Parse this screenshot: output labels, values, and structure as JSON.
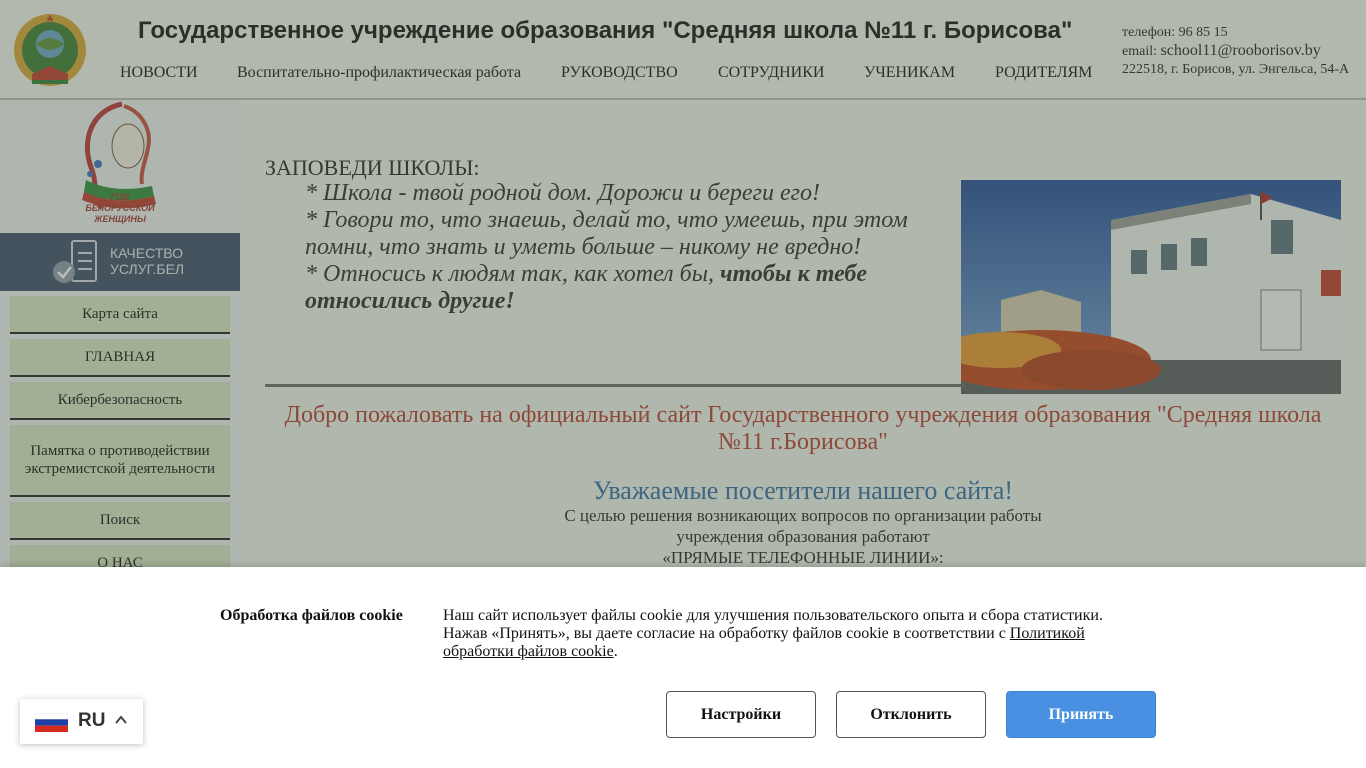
{
  "header": {
    "title": "Государственное учреждение образования \"Средняя школа №11 г. Борисова\"",
    "nav": [
      "НОВОСТИ",
      "Воспитательно-профилактическая работа",
      "РУКОВОДСТВО",
      "СОТРУДНИКИ",
      "УЧЕНИКАМ",
      "РОДИТЕЛЯМ"
    ],
    "contacts": {
      "phone": "телефон: 96 85 15",
      "email_label": "email:",
      "email": "school11@rooborisov.by",
      "address": "222518, г. Борисов, ул. Энгельса, 54-А"
    }
  },
  "sidebar": {
    "women_logo_text": [
      "ГОД",
      "БЕЛОРУССКОЙ",
      "ЖЕНЩИНЫ"
    ],
    "quality_banner": [
      "КАЧЕСТВО",
      "УСЛУГ.БЕЛ"
    ],
    "menu": [
      "Карта сайта",
      "ГЛАВНАЯ",
      "Кибербезопасность",
      "Памятка о противодействии экстремистской деятельности",
      "Поиск",
      "О НАС"
    ]
  },
  "main": {
    "commandments_title": "ЗАПОВЕДИ ШКОЛЫ:",
    "commandments": [
      "* Школа - твой родной дом. Дорожи и береги его!",
      "* Говори то, что знаешь, делай то, что умеешь, при этом помни, что знать и уметь больше – никому не вредно!"
    ],
    "commandment_3_plain": "* Относись к людям так, как хотел бы,",
    "commandment_3_bold": "чтобы к тебе относились другие!",
    "welcome": "Добро пожаловать на официальный сайт Государственного учреждения образования \"Средняя школа №11 г.Борисова\"",
    "visitors_title": "Уважаемые посетители нашего сайта!",
    "hotline_lines": [
      "С целью решения возникающих вопросов по организации работы",
      "учреждения образования работают",
      "«ПРЯМЫЕ ТЕЛЕФОННЫЕ ЛИНИИ»:"
    ]
  },
  "cookie": {
    "title": "Обработка файлов cookie",
    "text_line1": "Наш сайт использует файлы cookie для улучшения пользовательского опыта и сбора статистики.",
    "text_line2": "Нажав «Принять», вы даете согласие на обработку файлов cookie в соответствии с",
    "policy_link": "Политикой обработки файлов cookie",
    "buttons": {
      "settings": "Настройки",
      "decline": "Отклонить",
      "accept": "Принять"
    }
  },
  "language": {
    "code": "RU",
    "flag": "russia-flag-icon"
  },
  "colors": {
    "welcome": "#b63a2e",
    "visitors": "#2f6aa6",
    "accept_button": "#4a90e2",
    "quality_banner": "#3f4b6c",
    "menu_item": "#d7e4c5"
  }
}
